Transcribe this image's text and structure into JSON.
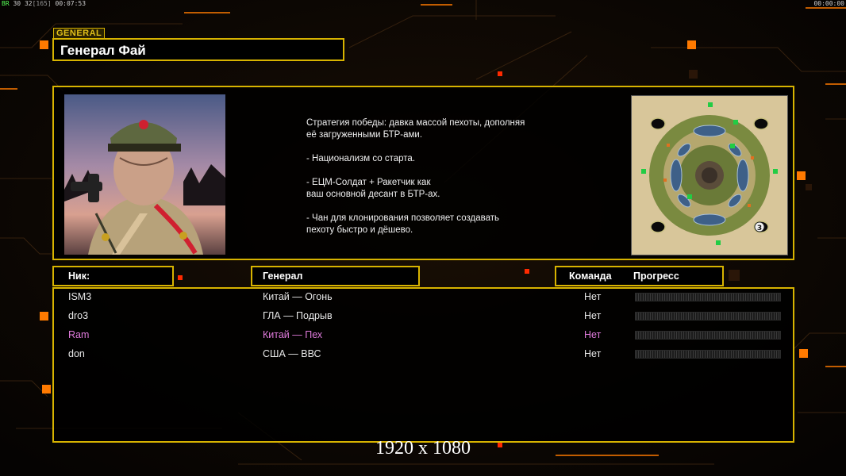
{
  "hud": {
    "left_label": "BR",
    "fps": "30",
    "fps2": "32",
    "latency": "[165]",
    "time": "00:07:53",
    "right_time": "00:00:00"
  },
  "general": {
    "tag": "GENERAL",
    "name": "Генерал Фай"
  },
  "strategy": {
    "text": "Стратегия победы: давка массой пехоты, дополняя\n её загруженными БТР-ами.\n\n- Национализм со старта.\n\n- ЕЦМ-Солдат + Ракетчик как\nваш основной десант в БТР-ах.\n\n- Чан для клонирования позволяет создавать\n пехоту быстро и дёшево."
  },
  "minimap": {
    "slot_number": "3"
  },
  "columns": {
    "nick": "Ник:",
    "general": "Генерал",
    "team": "Команда",
    "progress": "Прогресс"
  },
  "players": [
    {
      "nick": "ISM3",
      "general": "Китай — Огонь",
      "team": "Нет",
      "progress": 0,
      "color": "#e8e8e8"
    },
    {
      "nick": "dro3",
      "general": "ГЛА — Подрыв",
      "team": "Нет",
      "progress": 0,
      "color": "#e8e8e8"
    },
    {
      "nick": "Ram",
      "general": "Китай — Пех",
      "team": "Нет",
      "progress": 0,
      "color": "#e07bdc"
    },
    {
      "nick": "don",
      "general": "США — ВВС",
      "team": "Нет",
      "progress": 0,
      "color": "#e8e8e8"
    }
  ],
  "resolution": "1920 x 1080",
  "colors": {
    "frame": "#d7b300",
    "accent_orange": "#ff7a00",
    "accent_red": "#ff2a00"
  }
}
